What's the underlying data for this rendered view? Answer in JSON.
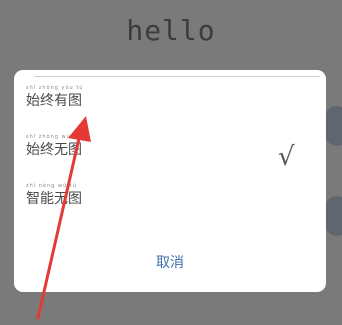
{
  "background": {
    "title": "hello"
  },
  "dialog": {
    "options": [
      {
        "pinyin": "shǐ zhōng yǒu tú",
        "label": "始终有图",
        "selected": false
      },
      {
        "pinyin": "shǐ zhōng wú tú",
        "label": "始终无图",
        "selected": true
      },
      {
        "pinyin": "zhì néng wú tú",
        "label": "智能无图",
        "selected": false
      }
    ],
    "check_mark": "√",
    "cancel_label": "取消"
  },
  "annotation": {
    "arrow_color": "#e53935"
  },
  "colors": {
    "overlay": "#7a7a7a",
    "dialog_bg": "#ffffff",
    "cancel": "#3e6fb0"
  }
}
